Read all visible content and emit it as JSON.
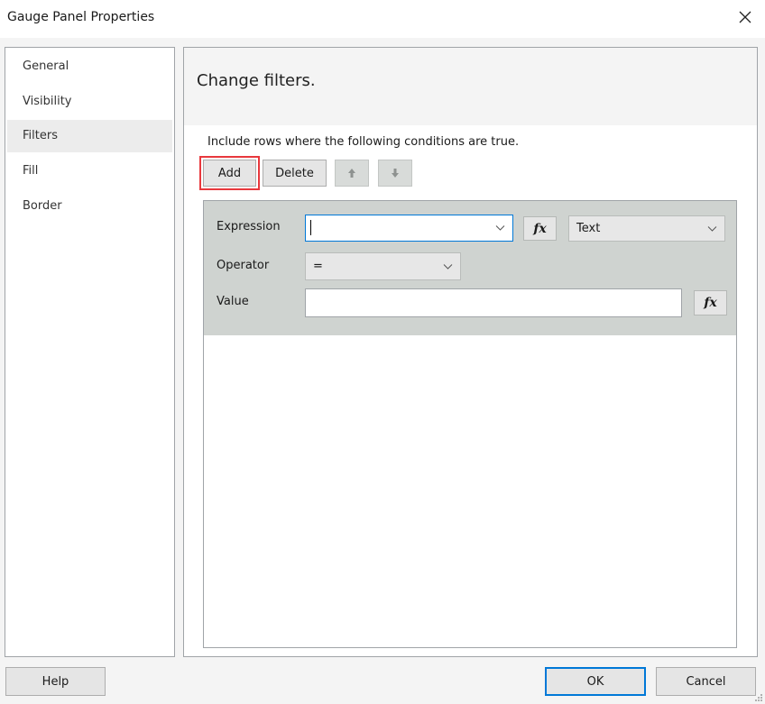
{
  "window": {
    "title": "Gauge Panel Properties",
    "close_icon": "close-icon"
  },
  "sidebar": {
    "items": [
      {
        "label": "General",
        "active": false
      },
      {
        "label": "Visibility",
        "active": false
      },
      {
        "label": "Filters",
        "active": true
      },
      {
        "label": "Fill",
        "active": false
      },
      {
        "label": "Border",
        "active": false
      }
    ]
  },
  "panel": {
    "title": "Change filters.",
    "instructions": "Include rows where the following conditions are true.",
    "toolbar": {
      "add_label": "Add",
      "delete_label": "Delete",
      "move_up_icon": "arrow-up-icon",
      "move_down_icon": "arrow-down-icon",
      "highlight_color": "#e8383d"
    },
    "filter": {
      "expression_label": "Expression",
      "expression_value": "",
      "type_value": "Text",
      "operator_label": "Operator",
      "operator_value": "=",
      "value_label": "Value",
      "value_value": "",
      "fx_label": "fx"
    }
  },
  "footer": {
    "help_label": "Help",
    "ok_label": "OK",
    "cancel_label": "Cancel"
  }
}
